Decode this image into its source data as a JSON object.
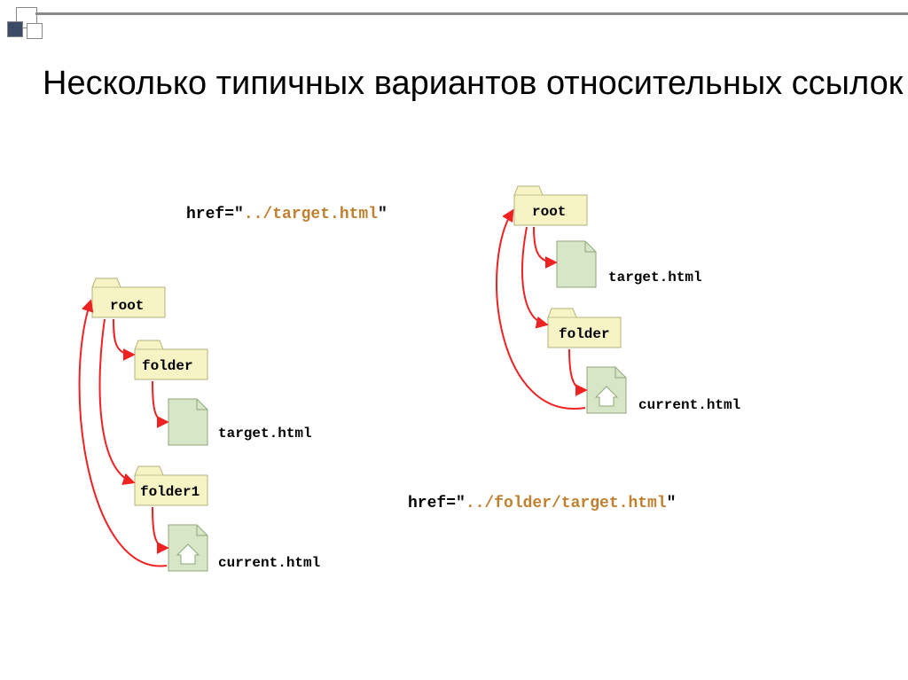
{
  "title": "Несколько типичных вариантов относительных ссылок",
  "left": {
    "code_kw": "href=\"",
    "code_path": "../target.html",
    "code_close": "\"",
    "root": "root",
    "folder": "folder",
    "target": "target.html",
    "folder1": "folder1",
    "current": "current.html"
  },
  "right": {
    "code_kw": "href=\"",
    "code_path": "../folder/target.html",
    "code_close": "\"",
    "root": "root",
    "target": "target.html",
    "folder": "folder",
    "current": "current.html"
  },
  "colors": {
    "folder_fill": "#f6f3c4",
    "folder_stroke": "#b5b27a",
    "file_fill": "#d7e6c6",
    "file_stroke": "#8fa77a",
    "arrow": "#ee2222"
  }
}
